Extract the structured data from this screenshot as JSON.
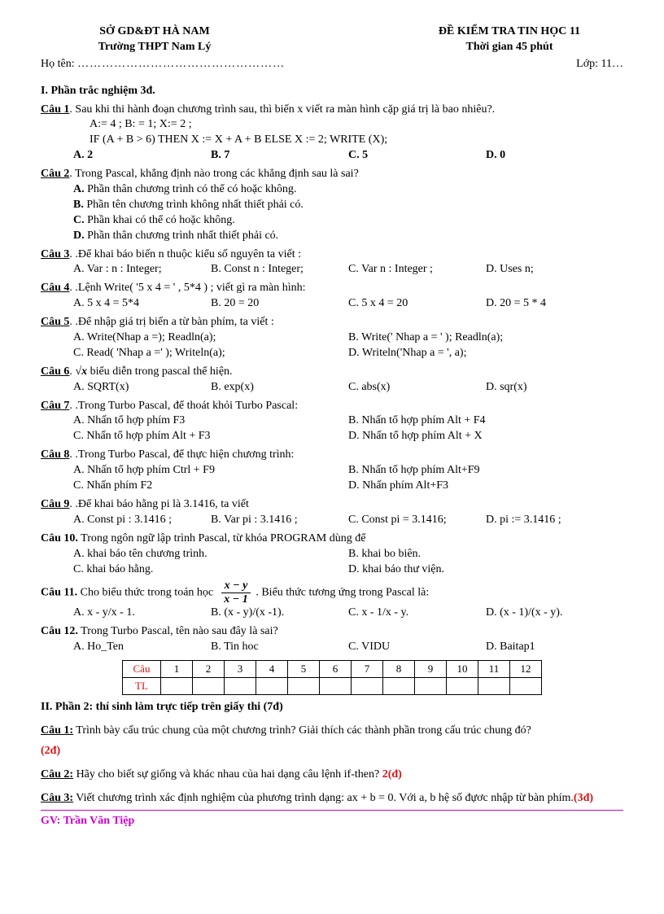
{
  "header": {
    "org": "SỞ GD&ĐT HÀ NAM",
    "school": "Trường THPT Nam Lý",
    "exam": "ĐỀ KIỂM TRA TIN HỌC 11",
    "duration": "Thời gian 45 phút",
    "name_label": "Họ tên:",
    "name_dots": "……………………………………………",
    "class_label": "Lớp: 11…"
  },
  "part1": {
    "title": "I.   Phần trắc nghiệm 3đ.",
    "q1": {
      "label": "Câu 1",
      "text": ". Sau khi thi hành đoạn chương trình sau, thì biến x viết ra màn hình cặp giá trị là  bao nhiêu?.",
      "line1": "A:= 4 ; B: = 1; X:= 2 ;",
      "line2": "IF (A + B > 6) THEN X := X + A + B ELSE X := 2; WRITE  (X);",
      "A": "A. 2",
      "B": "B. 7",
      "C": "C. 5",
      "D": "D. 0"
    },
    "q2": {
      "label": "Câu 2",
      "text": ". Trong Pascal, khẳng định nào trong các khẳng định sau là sai?",
      "A": "A. Phần thân chương trình có thể có hoặc không.",
      "B": "B. Phần tên chương trình không nhất thiết phải có.",
      "C": "C. Phần khai có thể có hoặc không.",
      "D": "D. Phần thân chương trình nhất thiết phải có."
    },
    "q3": {
      "label": "Câu 3",
      "text": ". .Để khai báo biến n thuộc kiểu số nguyên ta viết :",
      "A": "A. Var : n : Integer;",
      "B": "B. Const n : Integer;",
      "C": "C. Var n : Integer ;",
      "D": "D. Uses n;"
    },
    "q4": {
      "label": "Câu 4",
      "text": ". .Lệnh Write( '5 x 4 = ' , 5*4 ) ; viết gì ra màn hình:",
      "A": "A. 5 x 4 = 5*4",
      "B": "B. 20 = 20",
      "C": "C. 5 x 4 = 20",
      "D": "D. 20 = 5 * 4"
    },
    "q5": {
      "label": "Câu 5",
      "text": ". .Để nhập giá trị biến a từ bàn phím, ta viết :",
      "A": "A. Write(Nhap a =); Readln(a);",
      "B": "B. Write(' Nhap a = ' ); Readln(a);",
      "C": "C. Read( 'Nhap a =' ); Writeln(a);",
      "D": "D. Writeln('Nhap a = ', a);"
    },
    "q6": {
      "label": "Câu 6",
      "sqrt": "√x",
      "text": " biểu diễn trong pascal thể hiện.",
      "A": "A. SQRT(x)",
      "B": "B. exp(x)",
      "C": "C. abs(x)",
      "D": "D. sqr(x)"
    },
    "q7": {
      "label": "Câu 7",
      "text": ". .Trong Turbo Pascal, để thoát khỏi Turbo Pascal:",
      "A": "A. Nhấn tổ hợp phím F3",
      "B": "B. Nhấn tổ hợp phím Alt + F4",
      "C": "C. Nhấn tổ hợp phím Alt + F3",
      "D": "D. Nhấn tổ hợp phím Alt + X"
    },
    "q8": {
      "label": "Câu 8",
      "text": ". .Trong Turbo Pascal, để thực hiện chương trình:",
      "A": "A. Nhấn tổ hợp phím Ctrl + F9",
      "B": "B. Nhấn tổ hợp phím Alt+F9",
      "C": "C. Nhấn phím F2",
      "D": "D. Nhấn phím Alt+F3"
    },
    "q9": {
      "label": "Câu 9",
      "text": ". .Để khai báo hằng pi là 3.1416, ta viết",
      "A": "A. Const pi : 3.1416 ;",
      "B": "B. Var pi : 3.1416 ;",
      "C": "C. Const pi = 3.1416;",
      "D": "D. pi := 3.1416 ;"
    },
    "q10": {
      "label": "Câu 10.",
      "text": " Trong ngôn ngữ lập trình Pascal, từ khóa PROGRAM dùng để",
      "A": "A. khai báo tên chương trình.",
      "B": "B. khai bo biên.",
      "C": "C. khai báo hằng.",
      "D": "D. khai báo thư viện."
    },
    "q11": {
      "label": "Câu 11.",
      "pre": " Cho biểu thức trong toán học",
      "numer": "x − y",
      "denom": "x − 1",
      "post": ". Biểu thức tương ứng trong Pascal là:",
      "A": "A. x - y/x - 1.",
      "B": "B. (x - y)/(x -1).",
      "C": "C. x - 1/x - y.",
      "D": "D. (x - 1)/(x - y)."
    },
    "q12": {
      "label": "Câu 12.",
      "text": " Trong Turbo Pascal, tên nào sau đây là sai?",
      "A": "A. Ho_Ten",
      "B": "B. Tin hoc",
      "C": "C. VIDU",
      "D": "D. Baitap1"
    }
  },
  "answer_table": {
    "row_label1": "Câu",
    "row_label2": "TL",
    "cols": [
      "1",
      "2",
      "3",
      "4",
      "5",
      "6",
      "7",
      "8",
      "9",
      "10",
      "11",
      "12"
    ]
  },
  "part2": {
    "title": "II.  Phần 2: thí sinh làm trực tiếp trên giấy thi (7đ)",
    "q1": {
      "label": "Câu 1:",
      "text": " Trình bày cấu trúc chung của một chương trình? Giải thích các thành phần trong cấu trúc chung đó?",
      "score": "(2đ)"
    },
    "q2": {
      "label": "Câu 2:",
      "text": " Hãy cho biết sự giống và khác nhau của hai dạng câu lệnh if-then? ",
      "score": "2(đ)"
    },
    "q3": {
      "label": "Câu 3:",
      "text": " Viết chương trình xác định nghiệm của phương trình dạng: ax + b = 0. Với a, b hệ số đựơc nhập từ bàn phím.",
      "score": "(3đ)"
    }
  },
  "footer": {
    "gv_label": "GV:",
    "gv_name": " Trần Văn Tiệp"
  }
}
